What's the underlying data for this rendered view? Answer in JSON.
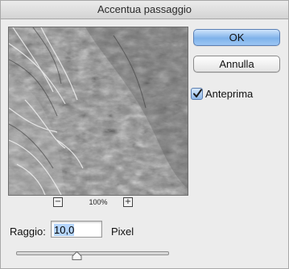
{
  "window": {
    "title": "Accentua passaggio"
  },
  "preview": {
    "zoom": "100%",
    "zoom_out_icon": "minus",
    "zoom_in_icon": "plus"
  },
  "buttons": {
    "ok": "OK",
    "cancel": "Annulla"
  },
  "preview_toggle": {
    "label": "Anteprima",
    "checked": true
  },
  "radius": {
    "label": "Raggio:",
    "value": "10,0",
    "unit": "Pixel"
  },
  "slider": {
    "position_fraction": 0.4
  },
  "colors": {
    "dialog_bg": "#ececec",
    "default_button": "#7fb2ea",
    "selection": "#b5d5fd"
  }
}
